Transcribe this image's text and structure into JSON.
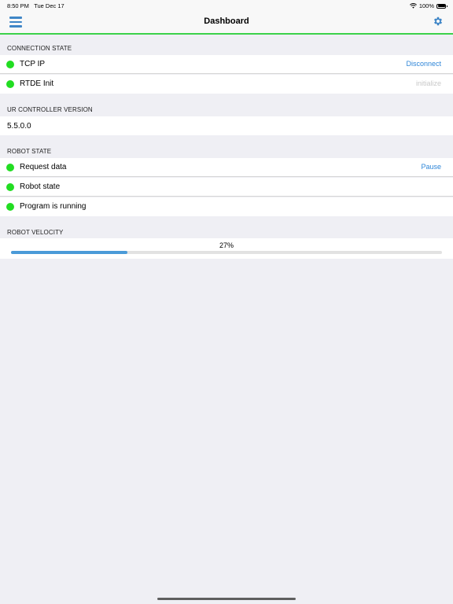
{
  "status_bar": {
    "time": "8:50 PM",
    "date": "Tue Dec 17",
    "battery": "100%"
  },
  "nav": {
    "title": "Dashboard"
  },
  "connection_state": {
    "header": "CONNECTION STATE",
    "items": [
      {
        "label": "TCP IP",
        "action": "Disconnect"
      },
      {
        "label": "RTDE Init",
        "action": "initialize"
      }
    ]
  },
  "controller_version": {
    "header": "UR CONTROLLER VERSION",
    "value": "5.5.0.0"
  },
  "robot_state": {
    "header": "ROBOT STATE",
    "items": [
      {
        "label": "Request data",
        "action": "Pause"
      },
      {
        "label": "Robot state"
      },
      {
        "label": "Program is running"
      }
    ]
  },
  "robot_velocity": {
    "header": "ROBOT VELOCITY",
    "percent_label": "27%",
    "percent": 27
  },
  "colors": {
    "accent": "#2f86d8",
    "status_ok": "#22dd22",
    "nav_border": "#3cd24a",
    "progress": "#4a9ad8"
  },
  "icons": {
    "menu": "hamburger-menu-icon",
    "settings": "gear-icon",
    "wifi": "wifi-icon",
    "battery": "battery-icon"
  }
}
